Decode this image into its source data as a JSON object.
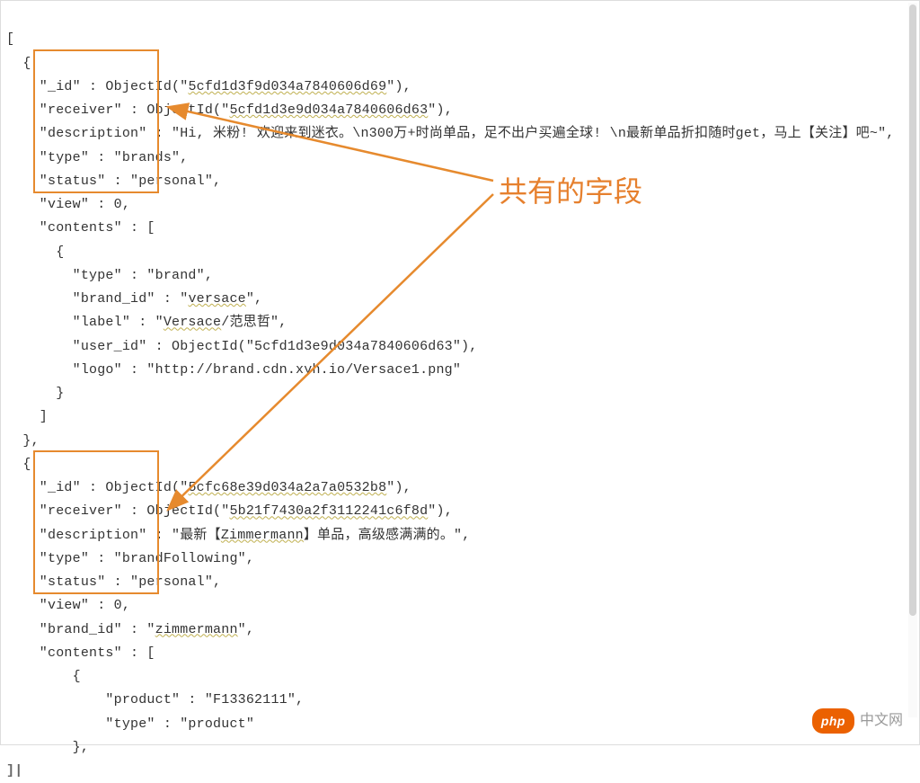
{
  "code": {
    "l1": "[",
    "l2": "  {",
    "l3_a": "    \"_id\" : ObjectId(\"",
    "l3_b": "5cfd1d3f9d034a7840606d69",
    "l3_c": "\"),",
    "l4_a": "    \"receiver\" : ObjectId(\"",
    "l4_b": "5cfd1d3e9d034a7840606d63",
    "l4_c": "\"),",
    "l5_a": "    \"description\" : \"Hi, 米粉! 欢迎来到迷衣。\\n300万+时尚单品，足不出户买遍全球! \\n最新单品折扣随时get，马上【关注】吧~\",",
    "l6": "    \"type\" : \"brands\",",
    "l7": "    \"status\" : \"personal\",",
    "l8": "    \"view\" : 0,",
    "l9": "    \"contents\" : [",
    "l10": "      {",
    "l11": "        \"type\" : \"brand\",",
    "l12_a": "        \"brand_id\" : \"",
    "l12_b": "versace",
    "l12_c": "\",",
    "l13_a": "        \"label\" : \"",
    "l13_b": "Versace",
    "l13_c": "/范思哲\",",
    "l14": "        \"user_id\" : ObjectId(\"5cfd1d3e9d034a7840606d63\"),",
    "l15": "        \"logo\" : \"http://brand.cdn.xyh.io/Versace1.png\"",
    "l16": "      }",
    "l17": "    ]",
    "l18": "  },",
    "l19": "  {",
    "l20_a": "    \"_id\" : ObjectId(\"",
    "l20_b": "5cfc68e39d034a2a7a0532b8",
    "l20_c": "\"),",
    "l21_a": "    \"receiver\" : ObjectId(\"",
    "l21_b": "5b21f7430a2f3112241c6f8d",
    "l21_c": "\"),",
    "l22_a": "    \"description\" : \"最新【",
    "l22_b": "Zimmermann",
    "l22_c": "】单品，高级感满满的。\",",
    "l23": "    \"type\" : \"brandFollowing\",",
    "l24": "    \"status\" : \"personal\",",
    "l25": "    \"view\" : 0,",
    "l26_a": "    \"brand_id\" : \"",
    "l26_b": "zimmermann",
    "l26_c": "\",",
    "l27": "    \"contents\" : [",
    "l28": "        {",
    "l29": "            \"product\" : \"F13362111\",",
    "l30": "            \"type\" : \"product\"",
    "l31": "        },",
    "caret": "]|"
  },
  "annotation": {
    "label": "共有的字段"
  },
  "watermark": {
    "badge": "php",
    "text": "中文网"
  }
}
